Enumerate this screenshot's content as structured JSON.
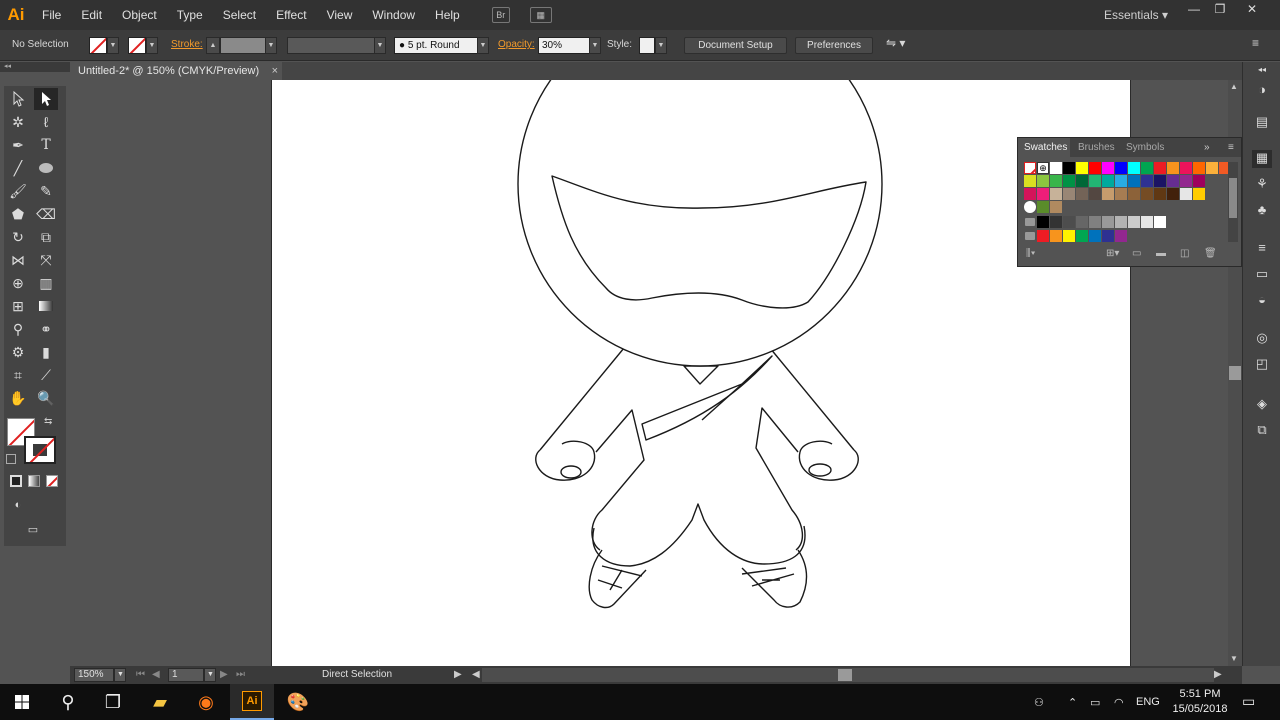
{
  "app": {
    "logo": "Ai",
    "workspace": "Essentials"
  },
  "menu": [
    "File",
    "Edit",
    "Object",
    "Type",
    "Select",
    "Effect",
    "View",
    "Window",
    "Help"
  ],
  "menu_buttons": {
    "bridge": "Br",
    "arrange": "▦"
  },
  "window_controls": {
    "minimize": "—",
    "restore": "❐",
    "close": "✕"
  },
  "control_bar": {
    "selection": "No Selection",
    "stroke_label": "Stroke:",
    "brush": "5 pt. Round",
    "opacity_label": "Opacity:",
    "opacity_value": "30%",
    "style_label": "Style:",
    "document_setup": "Document Setup",
    "preferences": "Preferences"
  },
  "document_tab": {
    "title": "Untitled-2* @ 150% (CMYK/Preview)",
    "close": "×"
  },
  "swatches_panel": {
    "tabs": [
      "Swatches",
      "Brushes",
      "Symbols"
    ],
    "active_tab": "Swatches",
    "row1": [
      "#ffffff",
      "#000000",
      "#ffff00",
      "#ff0000",
      "#ff00ff",
      "#0000ff",
      "#00ffff",
      "#00a651",
      "#ed1c24",
      "#f7941d",
      "#ed145b",
      "#ff6600",
      "#fbb03b",
      "#f15a24"
    ],
    "row2": [
      "#d9e021",
      "#8cc63f",
      "#39b54a",
      "#009245",
      "#006837",
      "#22b573",
      "#00a99d",
      "#29abe2",
      "#0071bc",
      "#2e3192",
      "#1b1464",
      "#662d91",
      "#93278f",
      "#9e005d"
    ],
    "row3": [
      "#d4145a",
      "#ed1e79",
      "#c7b299",
      "#998675",
      "#736357",
      "#534741",
      "#c69c6d",
      "#a67c52",
      "#8c6239",
      "#754c24",
      "#603813",
      "#42210b",
      "#e6e6e6",
      "#ffcc00"
    ],
    "row5": [
      "#000000",
      "#333333",
      "#4d4d4d",
      "#666666",
      "#808080",
      "#999999",
      "#b3b3b3",
      "#cccccc",
      "#e6e6e6",
      "#ffffff"
    ],
    "row6": [
      "#ed1c24",
      "#f7941d",
      "#fff200",
      "#00a651",
      "#0072bc",
      "#2e3192",
      "#92278f"
    ]
  },
  "status_bar": {
    "zoom": "150%",
    "artboard": "1",
    "tool": "Direct Selection"
  },
  "taskbar": {
    "language": "ENG",
    "time": "5:51 PM",
    "date": "15/05/2018"
  }
}
